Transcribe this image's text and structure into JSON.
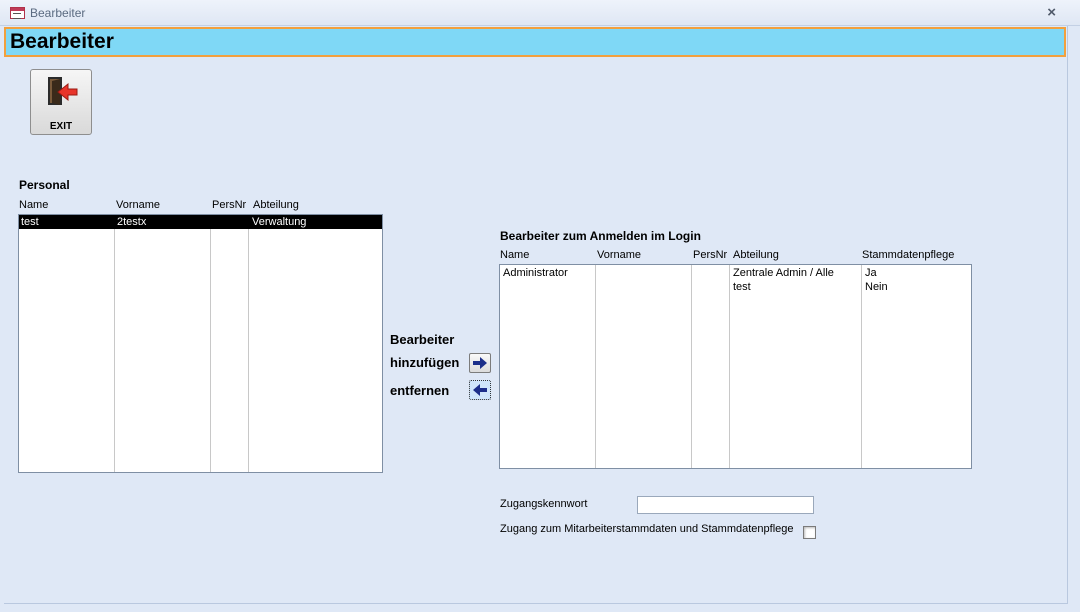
{
  "window": {
    "title": "Bearbeiter",
    "close_glyph": "×"
  },
  "header": {
    "title": "Bearbeiter"
  },
  "toolbar": {
    "exit_label": "EXIT",
    "exit_icon": "exit-door-icon"
  },
  "personal": {
    "title": "Personal",
    "columns": [
      "Name",
      "Vorname",
      "PersNr",
      "Abteilung"
    ],
    "rows": [
      {
        "name": "test",
        "vorname": "2testx",
        "persnr": "",
        "abteilung": "Verwaltung",
        "selected": true
      }
    ]
  },
  "transfer": {
    "line1": "Bearbeiter",
    "add_label": "hinzufügen",
    "remove_label": "entfernen",
    "add_icon": "arrow-right-icon",
    "remove_icon": "arrow-left-icon"
  },
  "login": {
    "title": "Bearbeiter zum Anmelden im Login",
    "columns": [
      "Name",
      "Vorname",
      "PersNr",
      "Abteilung",
      "Stammdatenpflege"
    ],
    "rows": [
      {
        "name": "Administrator",
        "vorname": "",
        "persnr": "",
        "abteilung": "Zentrale Admin / Alle",
        "stammdatenpflege": "Ja"
      },
      {
        "name": "",
        "vorname": "",
        "persnr": "",
        "abteilung": "test",
        "stammdatenpflege": "Nein"
      }
    ]
  },
  "access": {
    "password_label": "Zugangskennwort",
    "password_value": "",
    "master_data_label": "Zugang zum Mitarbeiterstammdaten und Stammdatenpflege",
    "master_data_checked": false
  },
  "colors": {
    "header_bg": "#7fd8f6",
    "header_border": "#f2a03d",
    "form_bg": "#dfe8f6",
    "selected_row_bg": "#000000"
  }
}
